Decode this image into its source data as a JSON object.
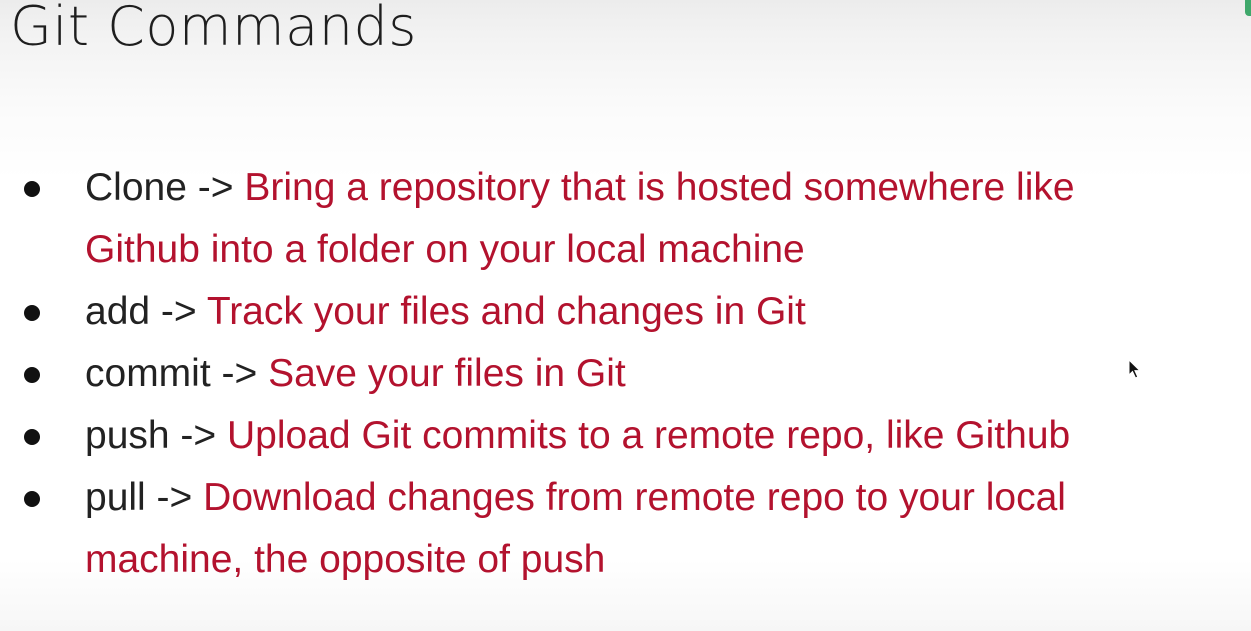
{
  "slide": {
    "title": "Git Commands",
    "items": [
      {
        "command": "Clone",
        "arrow": "->",
        "description_lines": [
          "Bring a repository that is hosted somewhere like",
          "Github into a folder on your local machine"
        ]
      },
      {
        "command": "add",
        "arrow": "->",
        "description_lines": [
          "Track your files and changes in Git"
        ]
      },
      {
        "command": "commit",
        "arrow": "->",
        "description_lines": [
          "Save your files in Git"
        ]
      },
      {
        "command": "push",
        "arrow": "->",
        "description_lines": [
          "Upload Git commits to a remote repo, like Github"
        ]
      },
      {
        "command": "pull",
        "arrow": "->",
        "description_lines": [
          "Download changes from remote repo to your local",
          "machine, the opposite of push"
        ]
      }
    ]
  },
  "colors": {
    "command_text": "#222222",
    "description_text": "#b3122e",
    "title_text": "#1e1e1e"
  },
  "icons": {
    "bullet": "bullet-dot-icon",
    "cursor": "mouse-pointer-icon"
  }
}
